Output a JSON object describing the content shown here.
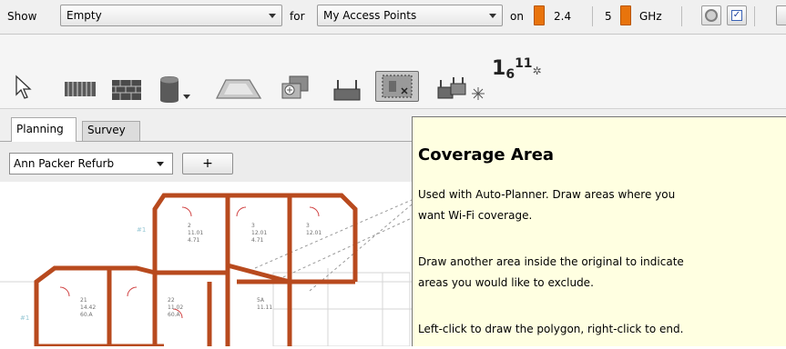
{
  "filter_bar": {
    "show_label": "Show",
    "show_value": "Empty",
    "for_label": "for",
    "for_value": "My Access Points",
    "on_label": "on",
    "band_24": "2.4",
    "band_5": "5",
    "ghz_label": "GHz",
    "band_color": "#e8740c"
  },
  "toolbar": {
    "tools": [
      "select-tool",
      "wall-tool",
      "brick-wall-tool",
      "pillar-tool",
      "area-tool",
      "copy-tool",
      "access-point-tool",
      "coverage-area-tool",
      "multi-access-point-tool",
      "channel-number-tool"
    ],
    "active_tool": "coverage-area-tool",
    "channel_icon": {
      "a": "1",
      "b": "6",
      "c": "11",
      "star": "✲"
    }
  },
  "tabs": [
    "Planning",
    "Survey"
  ],
  "active_tab": "Planning",
  "floor": {
    "selected": "Ann Packer Refurb",
    "add_label": "+"
  },
  "tooltip": {
    "title": "Coverage Area",
    "paragraph_1_line_1": "Used with Auto-Planner. Draw areas where you",
    "paragraph_1_line_2": "want Wi-Fi coverage.",
    "paragraph_2_line_1": "Draw another area inside the original to indicate",
    "paragraph_2_line_2": "areas you would like to exclude.",
    "paragraph_3": "Left-click to draw the polygon, right-click to end."
  },
  "colors": {
    "wall": "#b84a1e",
    "tooltip_bg": "#ffffe1"
  }
}
